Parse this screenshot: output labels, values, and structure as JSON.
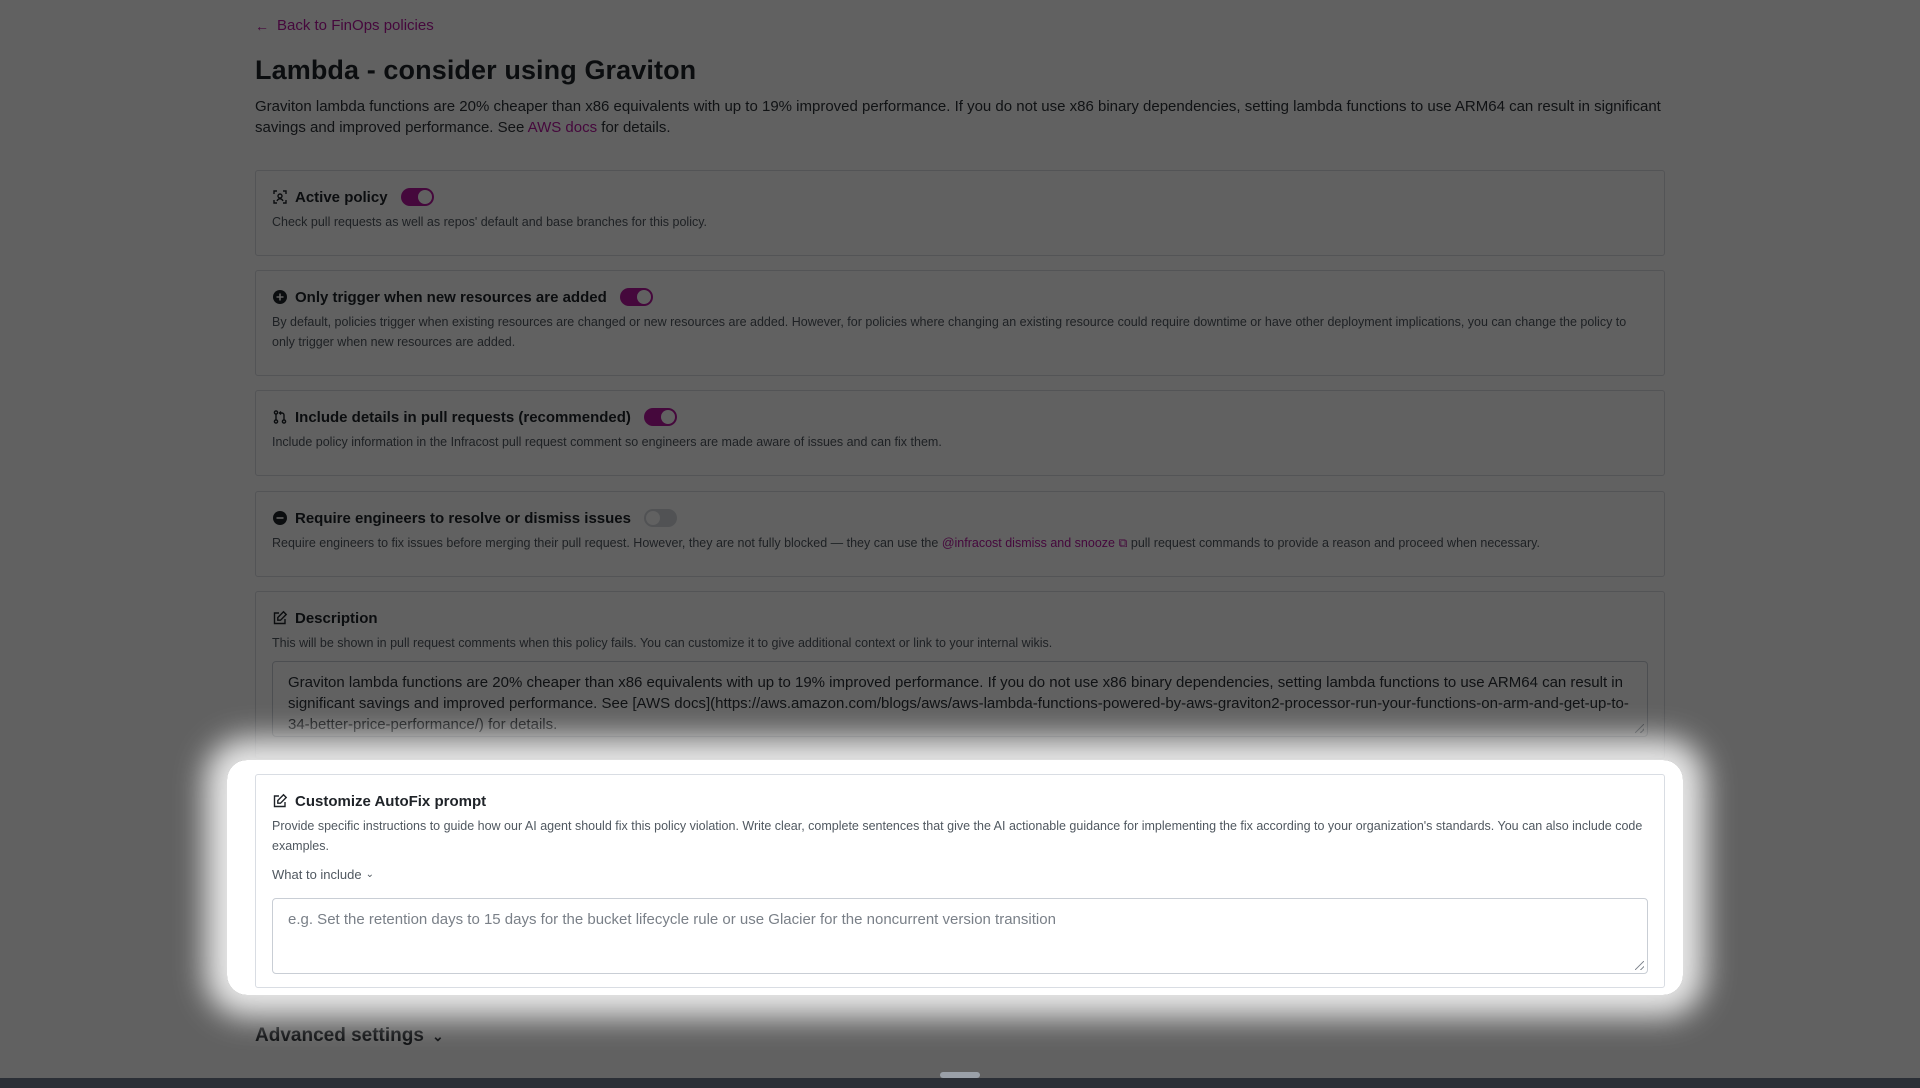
{
  "back_link": "Back to FinOps policies",
  "title": "Lambda - consider using Graviton",
  "intro": {
    "before_link": "Graviton lambda functions are 20% cheaper than x86 equivalents with up to 19% improved performance. If you do not use x86 binary dependencies, setting lambda functions to use ARM64 can result in significant savings and improved performance. See ",
    "link": "AWS docs",
    "after_link": " for details."
  },
  "cards": {
    "active": {
      "title": "Active policy",
      "desc": "Check pull requests as well as repos' default and base branches for this policy.",
      "toggle": "on"
    },
    "trigger": {
      "title": "Only trigger when new resources are added",
      "desc": "By default, policies trigger when existing resources are changed or new resources are added. However, for policies where changing an existing resource could require downtime or have other deployment implications, you can change the policy to only trigger when new resources are added.",
      "toggle": "on"
    },
    "details": {
      "title": "Include details in pull requests (recommended)",
      "desc": "Include policy information in the Infracost pull request comment so engineers are made aware of issues and can fix them.",
      "toggle": "on"
    },
    "require": {
      "title": "Require engineers to resolve or dismiss issues",
      "desc_before": "Require engineers to fix issues before merging their pull request. However, they are not fully blocked — they can use the ",
      "desc_link": "@infracost dismiss and snooze",
      "desc_after": " pull request commands to provide a reason and proceed when necessary.",
      "toggle": "off"
    },
    "description": {
      "title": "Description",
      "desc": "This will be shown in pull request comments when this policy fails. You can customize it to give additional context or link to your internal wikis.",
      "value": "Graviton lambda functions are 20% cheaper than x86 equivalents with up to 19% improved performance. If you do not use x86 binary dependencies, setting lambda functions to use ARM64 can result in significant savings and improved performance. See [AWS docs](https://aws.amazon.com/blogs/aws/aws-lambda-functions-powered-by-aws-graviton2-processor-run-your-functions-on-arm-and-get-up-to-34-better-price-performance/) for details."
    },
    "autofix": {
      "title": "Customize AutoFix prompt",
      "desc": "Provide specific instructions to guide how our AI agent should fix this policy violation. Write clear, complete sentences that give the AI actionable guidance for implementing the fix according to your organization's standards. You can also include code examples.",
      "what_include": "What to include",
      "placeholder": "e.g. Set the retention days to 15 days for the bucket lifecycle rule or use Glacier for the noncurrent version transition"
    }
  },
  "advanced": "Advanced settings",
  "accent_color": "#b5179e"
}
